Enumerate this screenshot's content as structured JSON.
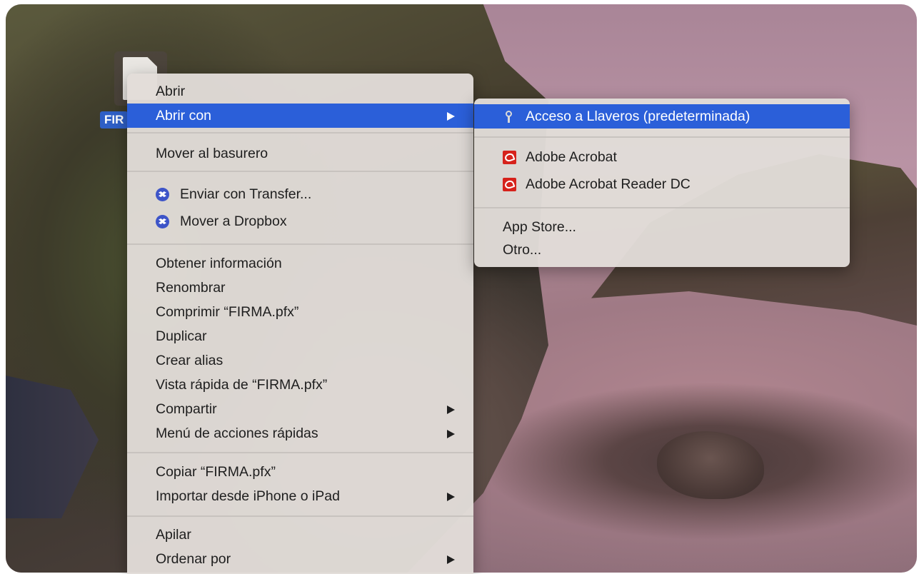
{
  "desktop": {
    "file_label": "FIR"
  },
  "context_menu": {
    "groups": [
      [
        {
          "label": "Abrir",
          "submenu": false
        },
        {
          "label": "Abrir con",
          "submenu": true,
          "highlighted": true
        }
      ],
      [
        {
          "label": "Mover al basurero",
          "submenu": false
        }
      ],
      [
        {
          "label": "Enviar con Transfer...",
          "icon": "dropbox-icon"
        },
        {
          "label": "Mover a Dropbox",
          "icon": "dropbox-icon"
        }
      ],
      [
        {
          "label": "Obtener información"
        },
        {
          "label": "Renombrar"
        },
        {
          "label": "Comprimir “FIRMA.pfx”"
        },
        {
          "label": "Duplicar"
        },
        {
          "label": "Crear alias"
        },
        {
          "label": "Vista rápida de “FIRMA.pfx”"
        },
        {
          "label": "Compartir",
          "submenu": true
        },
        {
          "label": "Menú de acciones rápidas",
          "submenu": true
        }
      ],
      [
        {
          "label": "Copiar “FIRMA.pfx”"
        },
        {
          "label": "Importar desde iPhone o iPad",
          "submenu": true
        }
      ],
      [
        {
          "label": "Apilar"
        },
        {
          "label": "Ordenar por",
          "submenu": true
        }
      ]
    ]
  },
  "open_with_submenu": {
    "items": [
      {
        "label": "Acceso a Llaveros (predeterminada)",
        "icon": "keychain-icon",
        "highlighted": true
      },
      {
        "label": "Adobe Acrobat",
        "icon": "acrobat-icon"
      },
      {
        "label": "Adobe Acrobat Reader DC",
        "icon": "acrobat-icon"
      },
      {
        "label": "App Store..."
      },
      {
        "label": "Otro..."
      }
    ]
  },
  "colors": {
    "highlight": "#2b5fd9",
    "menu_bg": "#e2ddd8",
    "file_label_bg": "#2f5fc6"
  }
}
